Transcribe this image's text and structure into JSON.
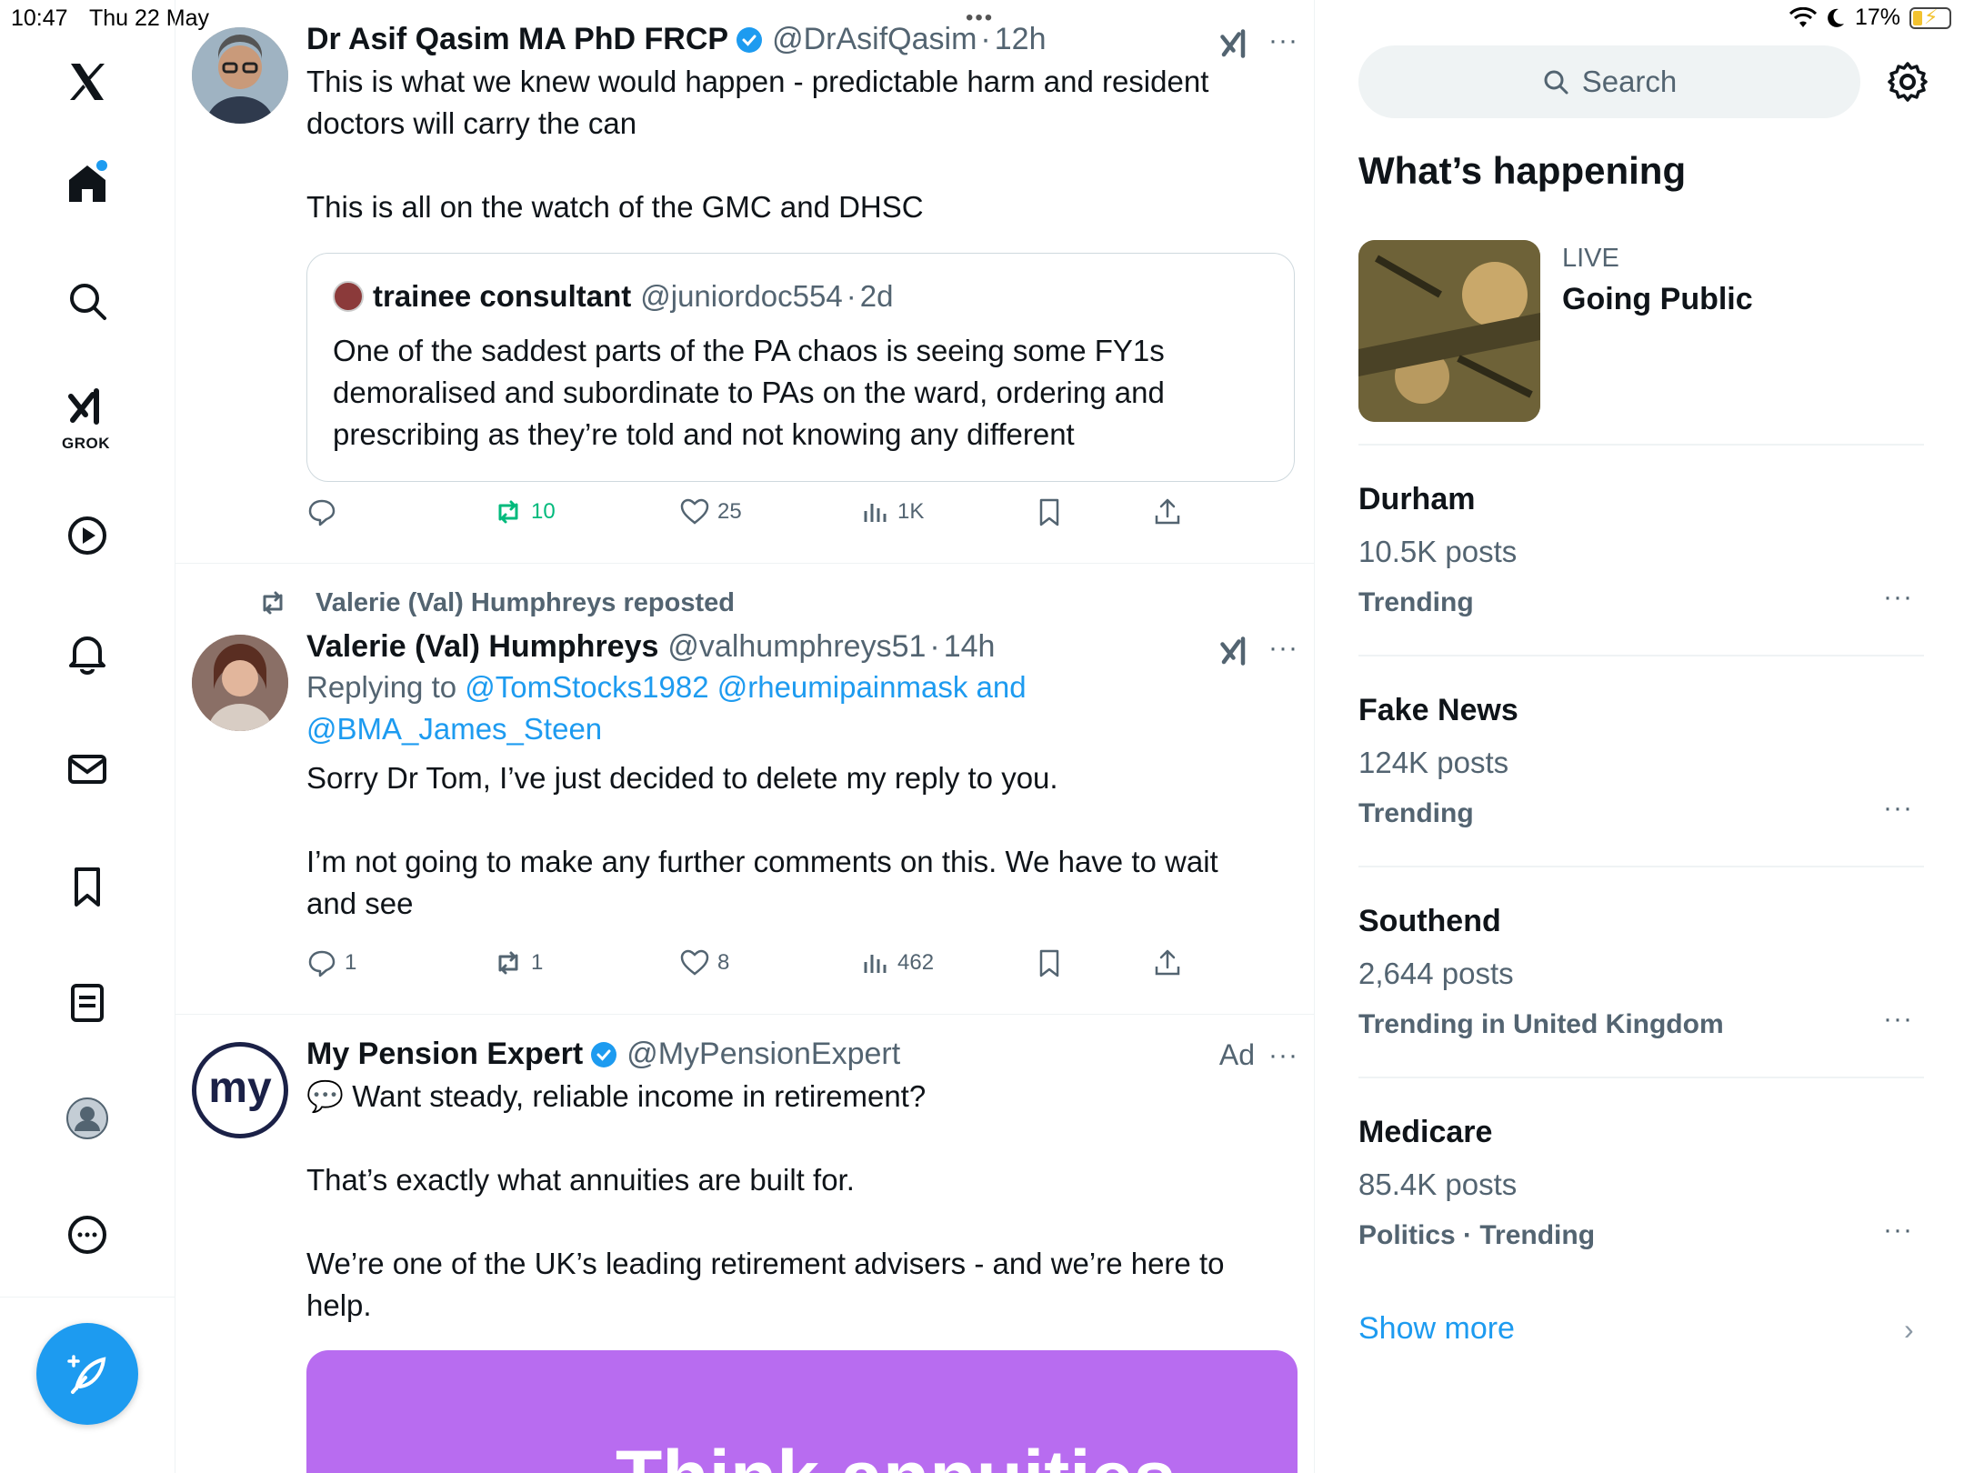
{
  "status_bar": {
    "time": "10:47",
    "date": "Thu 22 May",
    "battery": "17%",
    "battery_level": 0.17
  },
  "nav": {
    "items": [
      "X logo",
      "Home",
      "Explore",
      "Grok",
      "Videos",
      "Notifications",
      "Messages",
      "Bookmarks",
      "Lists",
      "Profile",
      "More"
    ],
    "grok_label": "GROK"
  },
  "feed": {
    "tweet1": {
      "name": "Dr Asif Qasim MA PhD FRCP",
      "handle": "@DrAsifQasim",
      "time": "12h",
      "text_line1": "This is what we knew would happen - predictable harm and resident doctors will carry the can",
      "text_line2": "This is all on the watch of the GMC and DHSC",
      "quote": {
        "name": "trainee consultant",
        "handle": "@juniordoc554",
        "time": "2d",
        "text": "One of the saddest parts of the PA chaos is seeing some FY1s demoralised and subordinate to PAs on the ward, ordering and prescribing as they’re told and not knowing any different"
      },
      "reposts": "10",
      "likes": "25",
      "views": "1K"
    },
    "tweet2": {
      "repost_by": "Valerie (Val) Humphreys reposted",
      "name": "Valerie (Val) Humphreys",
      "handle": "@valhumphreys51",
      "time": "14h",
      "replying_prefix": "Replying to",
      "replying_users": "@TomStocks1982 @rheumipainmask and @BMA_James_Steen",
      "text_line1": "Sorry Dr Tom, I’ve just decided to delete my reply to you.",
      "text_line2": "I’m not going to make any further comments on this. We have to wait and see",
      "replies": "1",
      "reposts": "1",
      "likes": "8",
      "views": "462"
    },
    "tweet3": {
      "name": "My Pension Expert",
      "handle": "@MyPensionExpert",
      "ad_label": "Ad",
      "avatar_text": "my",
      "text_line1": "💬 Want steady, reliable income in retirement?",
      "text_line2": "That’s exactly what annuities are built for.",
      "text_line3": "We’re one of the UK’s leading retirement advisers - and we’re here to help.",
      "promo_text": "Think annuities"
    }
  },
  "sidebar": {
    "search_placeholder": "Search",
    "title": "What’s happening",
    "live": {
      "label": "LIVE",
      "title": "Going Public"
    },
    "trends": [
      {
        "name": "Durham",
        "count": "10.5K posts",
        "meta": "Trending"
      },
      {
        "name": "Fake News",
        "count": "124K posts",
        "meta": "Trending"
      },
      {
        "name": "Southend",
        "count": "2,644 posts",
        "meta": "Trending in United Kingdom"
      },
      {
        "name": "Medicare",
        "count": "85.4K posts",
        "meta": "Politics · Trending"
      }
    ],
    "show_more": "Show more"
  },
  "colors": {
    "accent": "#1d9bf0",
    "repost_active": "#00ba7c",
    "text_secondary": "#536471",
    "promo_bg": "#b86cf0"
  }
}
